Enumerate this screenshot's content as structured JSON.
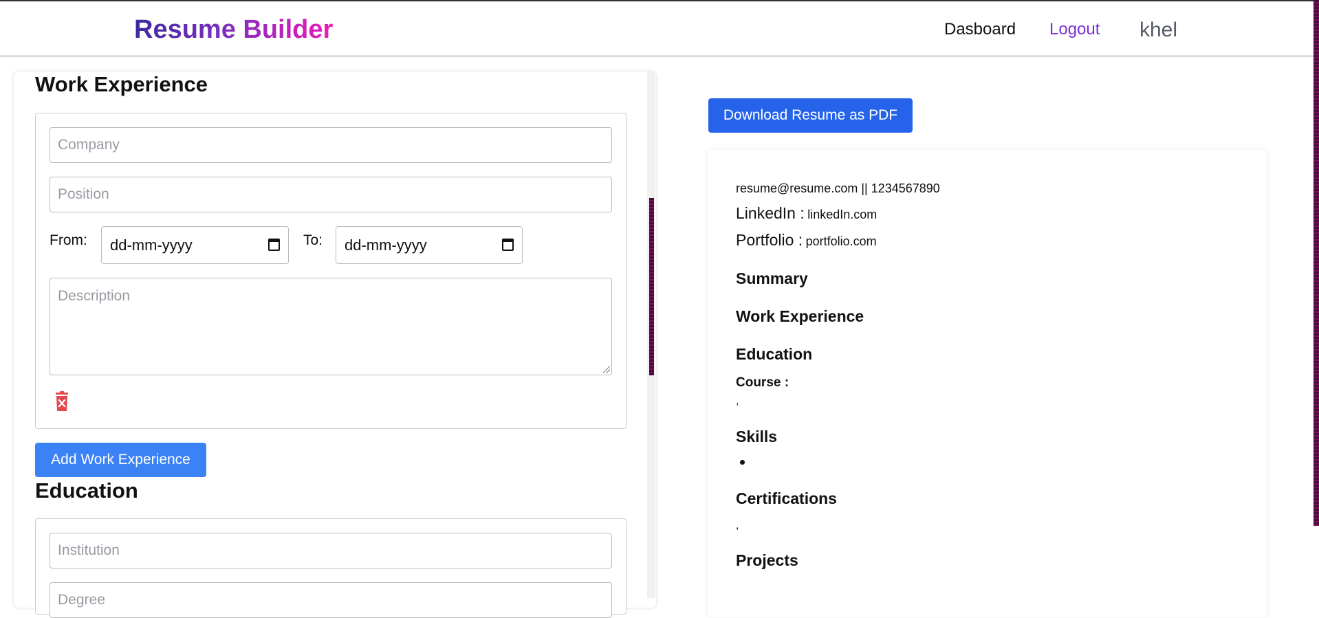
{
  "header": {
    "brand": "Resume Builder",
    "nav": {
      "dashboard": "Dasboard",
      "logout": "Logout",
      "user": "khel"
    }
  },
  "form": {
    "work_experience": {
      "title": "Work Experience",
      "company_placeholder": "Company",
      "position_placeholder": "Position",
      "from_label": "From:",
      "to_label": "To:",
      "from_value": "dd-mm-yyyy",
      "to_value": "dd-mm-yyyy",
      "description_placeholder": "Description",
      "delete_icon": "trash-x-icon",
      "add_button": "Add Work Experience"
    },
    "education": {
      "title": "Education",
      "institution_placeholder": "Institution",
      "degree_placeholder": "Degree"
    }
  },
  "preview": {
    "download_button": "Download Resume as PDF",
    "contact": "resume@resume.com || 1234567890",
    "linkedin_label": "LinkedIn :",
    "linkedin_value": "linkedIn.com",
    "portfolio_label": "Portfolio :",
    "portfolio_value": "portfolio.com",
    "headings": {
      "summary": "Summary",
      "work": "Work Experience",
      "education": "Education",
      "skills": "Skills",
      "certifications": "Certifications",
      "projects": "Projects"
    },
    "course_label": "Course :",
    "education_separator": ",",
    "certifications_separator": ","
  },
  "colors": {
    "brand_gradient": [
      "#3f2a9e",
      "#ec1ab8"
    ],
    "logout": "#7b2fd6",
    "add_button": "#3b82f6",
    "download_button": "#2563eb",
    "delete_icon": "#e5484d"
  }
}
